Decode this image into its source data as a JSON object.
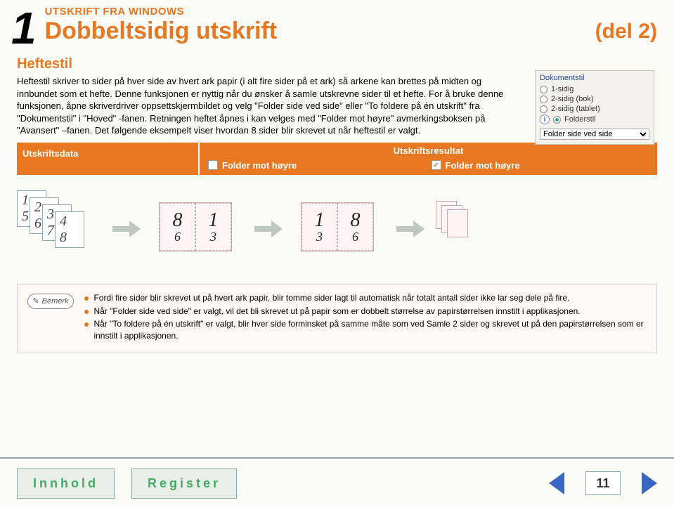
{
  "header": {
    "section_number": "1",
    "kicker": "UTSKRIFT FRA WINDOWS",
    "title": "Dobbeltsidig utskrift",
    "part": "(del 2)"
  },
  "subtitle": "Heftestil",
  "paragraph": "Heftestil skriver to sider på hver side av hvert ark papir (i alt fire sider på et ark) så arkene kan brettes på midten og innbundet som et hefte. Denne funksjonen er nyttig når du ønsker å samle utskrevne sider til et hefte.\nFor å bruke denne funksjonen, åpne skriverdriver oppsettskjermbildet og velg \"Folder side ved side\" eller \"To foldere på én utskrift\" fra \"Dokumentstil\" i \"Hoved\" -fanen.\nRetningen heftet åpnes i kan velges med \"Folder mot høyre\" avmerkingsboksen på \"Avansert\" –fanen.\nDet følgende eksempelt viser hvordan 8 sider blir skrevet ut når heftestil er valgt.",
  "table": {
    "col_data": "Utskriftsdata",
    "col_result": "Utskriftsresultat",
    "opt_unchecked": "Folder mot høyre",
    "opt_checked": "Folder mot høyre"
  },
  "stack_pages": [
    "1",
    "2",
    "3",
    "4",
    "5",
    "6",
    "7",
    "8"
  ],
  "spread1": {
    "top_left": "8",
    "top_right": "1",
    "bottom_left": "6",
    "bottom_right": "3"
  },
  "spread2": {
    "top_left": "1",
    "top_right": "8",
    "bottom_left": "3",
    "bottom_right": "6"
  },
  "bemerk_label": "Bemerk",
  "notes": [
    "Fordi fire sider blir skrevet ut på hvert ark papir, blir tomme sider lagt til automatisk når totalt antall sider ikke lar seg dele på fire.",
    "Når \"Folder side ved side\" er valgt, vil det bli skrevet ut på papir som er dobbelt størrelse av papirstørrelsen innstilt i applikasjonen.",
    "Når \"To foldere på én utskrift\" er valgt, blir hver side forminsket på samme måte som ved Samle 2 sider og skrevet ut på den papirstørrelsen som er innstilt i applikasjonen."
  ],
  "footer": {
    "contents": "Innhold",
    "index": "Register",
    "page": "11"
  },
  "panel": {
    "title": "Dokumentstil",
    "r1": "1-sidig",
    "r2": "2-sidig (bok)",
    "r3": "2-sidig (tablet)",
    "r4": "Folderstil",
    "select_value": "Folder side ved side"
  }
}
